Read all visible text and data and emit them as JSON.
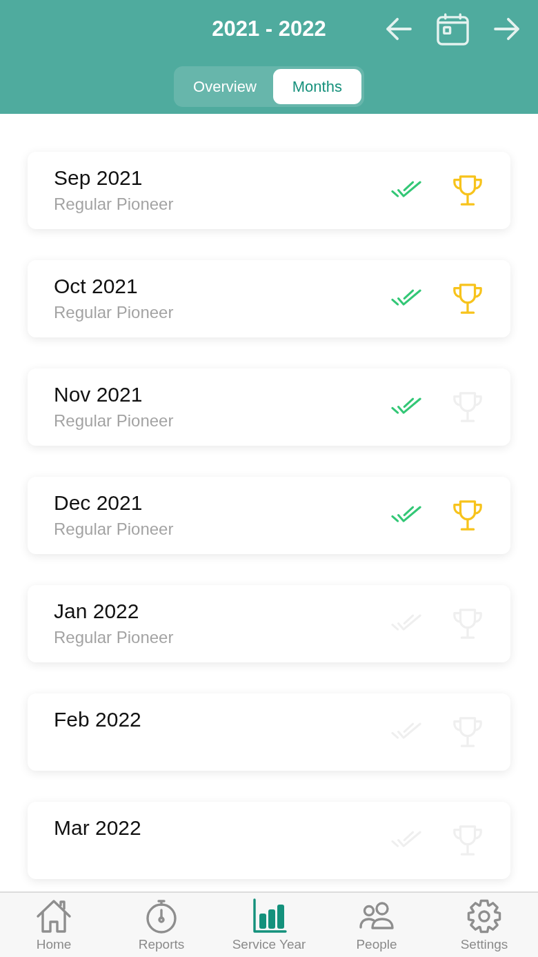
{
  "header": {
    "title": "2021 - 2022"
  },
  "tabs": [
    {
      "label": "Overview",
      "selected": false
    },
    {
      "label": "Months",
      "selected": true
    }
  ],
  "months": [
    {
      "title": "Sep 2021",
      "subtitle": "Regular Pioneer",
      "report_sent": true,
      "goal_reached": true
    },
    {
      "title": "Oct 2021",
      "subtitle": "Regular Pioneer",
      "report_sent": true,
      "goal_reached": true
    },
    {
      "title": "Nov 2021",
      "subtitle": "Regular Pioneer",
      "report_sent": true,
      "goal_reached": false
    },
    {
      "title": "Dec 2021",
      "subtitle": "Regular Pioneer",
      "report_sent": true,
      "goal_reached": true
    },
    {
      "title": "Jan 2022",
      "subtitle": "Regular Pioneer",
      "report_sent": false,
      "goal_reached": false
    },
    {
      "title": "Feb 2022",
      "report_sent": false,
      "goal_reached": false
    },
    {
      "title": "Mar 2022",
      "report_sent": false,
      "goal_reached": false
    }
  ],
  "nav": [
    {
      "label": "Home",
      "kind": "home",
      "selected": false
    },
    {
      "label": "Reports",
      "kind": "stopwatch",
      "selected": false
    },
    {
      "label": "Service Year",
      "kind": "chart",
      "selected": true
    },
    {
      "label": "People",
      "kind": "people",
      "selected": false
    },
    {
      "label": "Settings",
      "kind": "gear",
      "selected": false
    }
  ]
}
